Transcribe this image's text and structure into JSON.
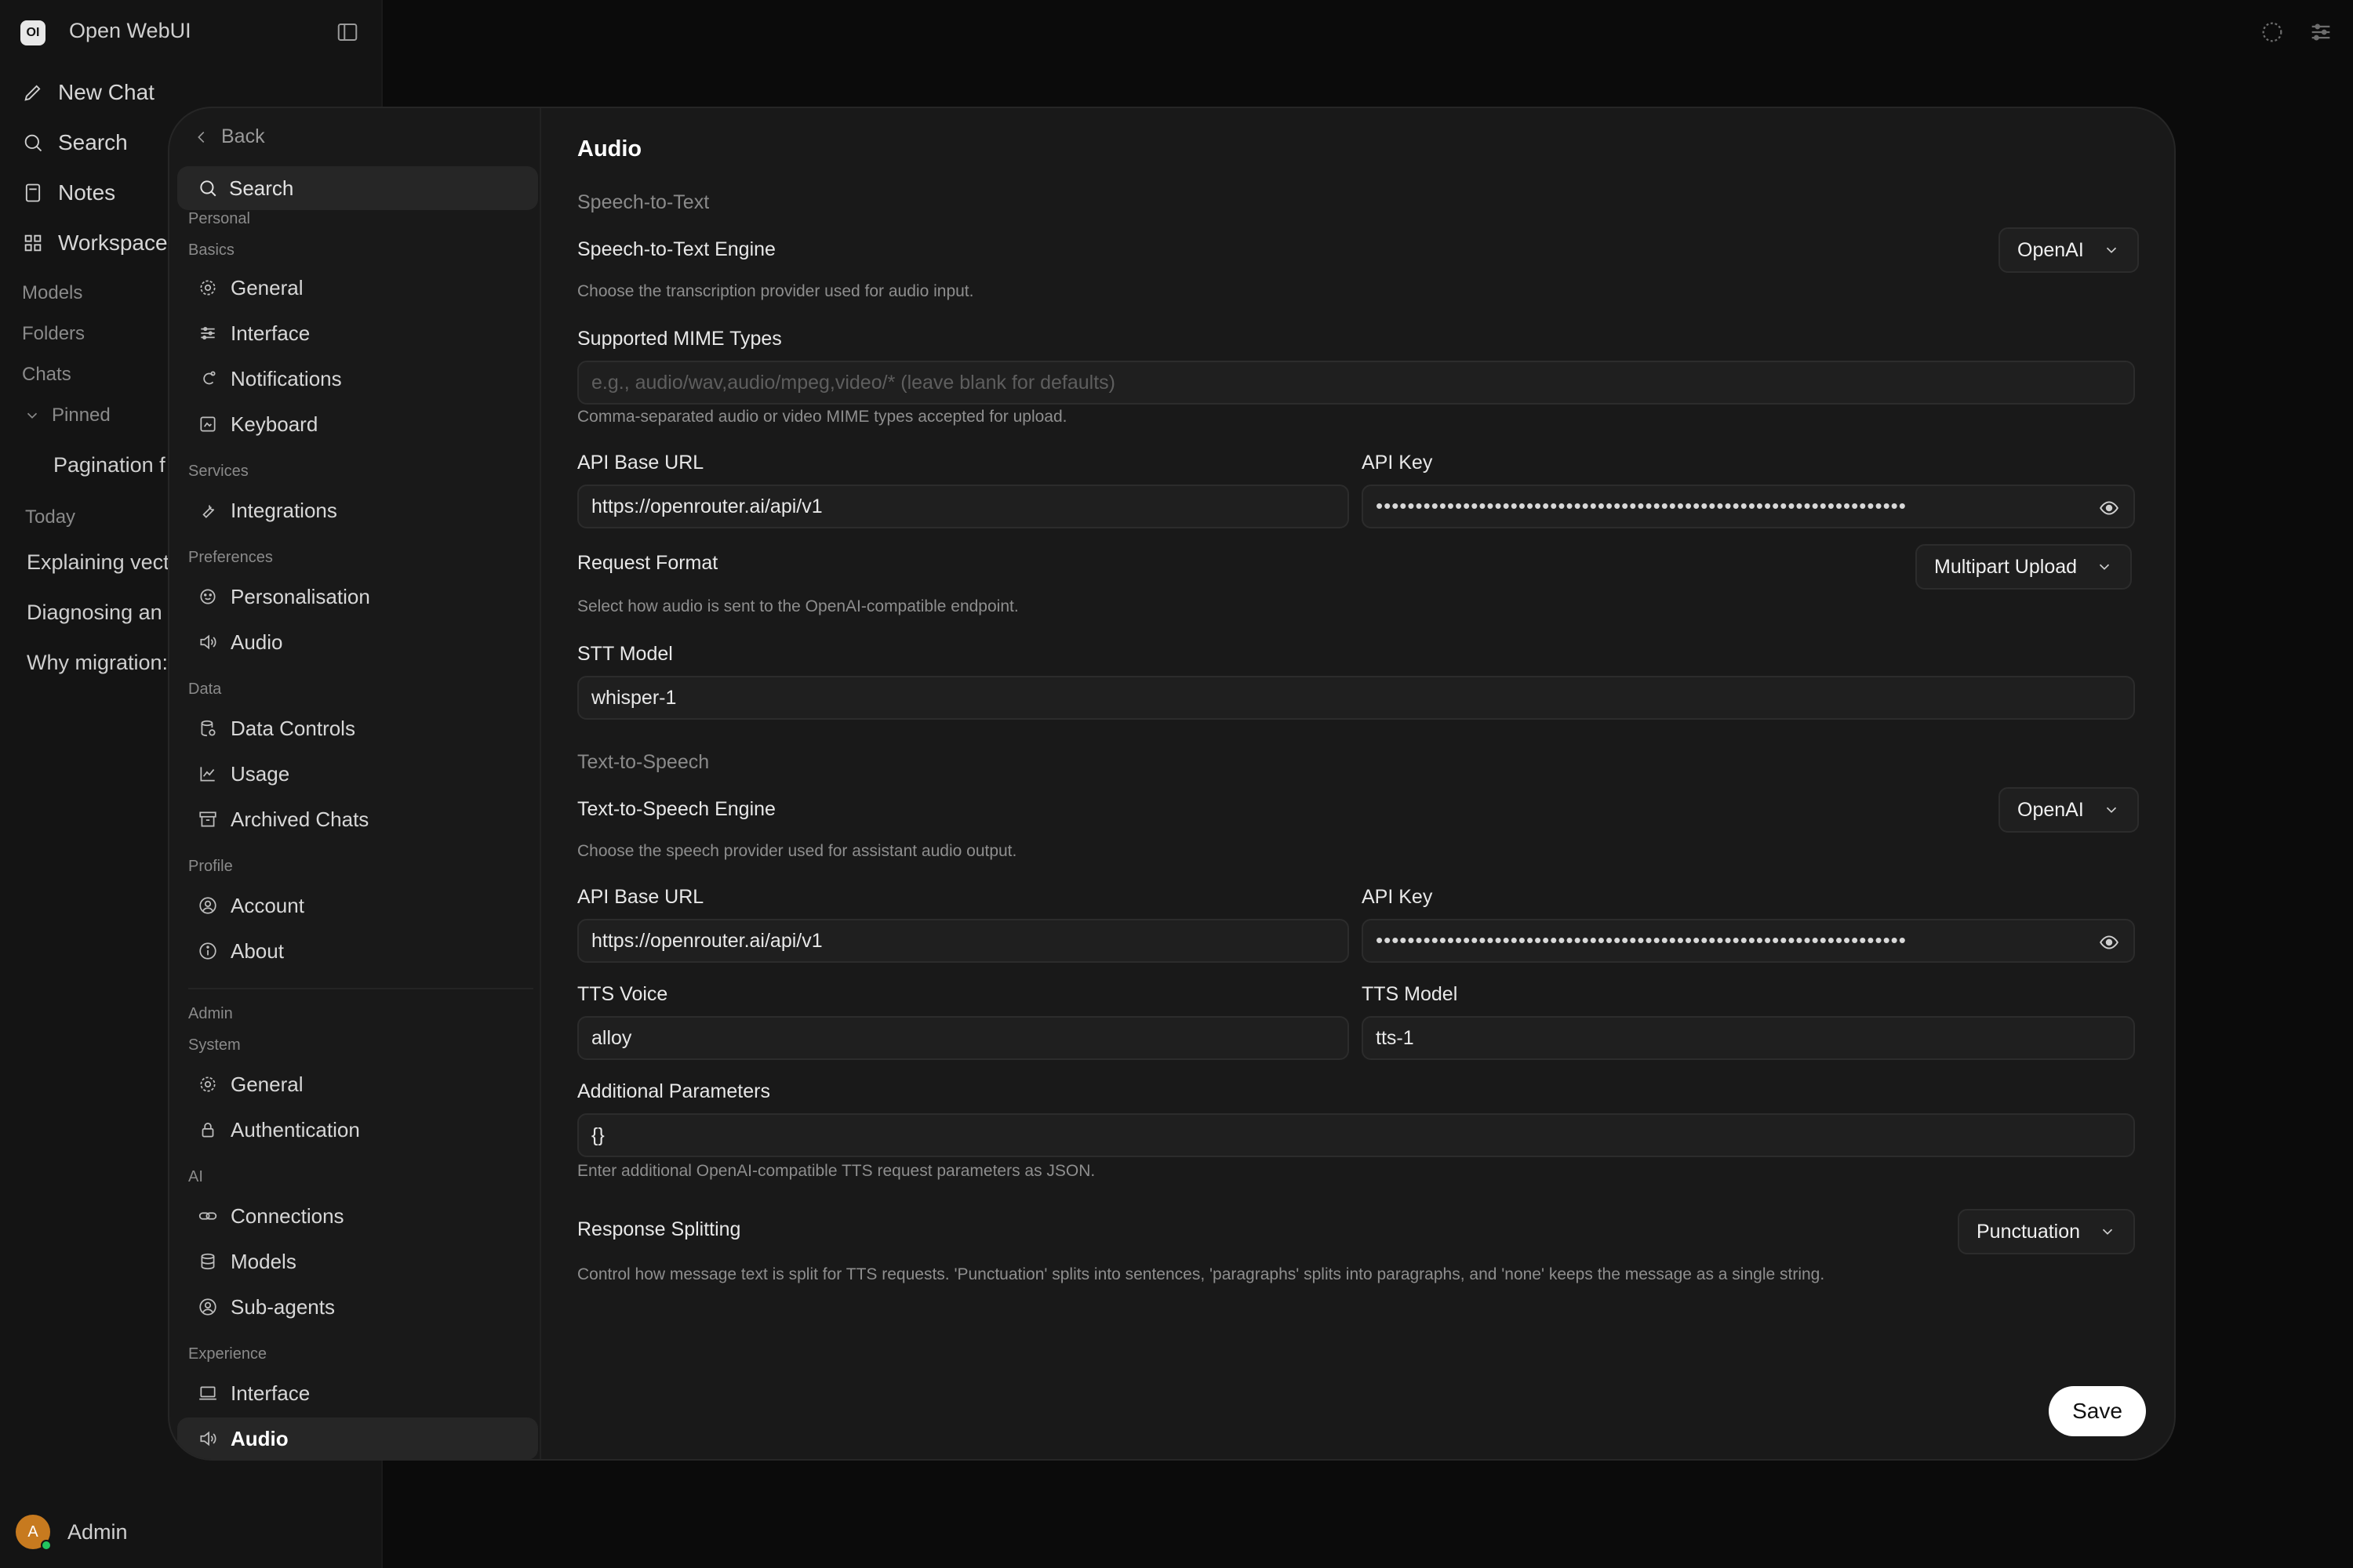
{
  "app": {
    "logo": "OI",
    "title": "Open WebUI"
  },
  "sidebar": {
    "nav": [
      {
        "label": "New Chat",
        "icon": "pencil-icon"
      },
      {
        "label": "Search",
        "icon": "search-icon"
      },
      {
        "label": "Notes",
        "icon": "notes-icon"
      },
      {
        "label": "Workspace",
        "icon": "grid-icon"
      }
    ],
    "sections": {
      "models": "Models",
      "folders": "Folders",
      "chats": "Chats",
      "pinned": "Pinned",
      "today": "Today"
    },
    "pinned_chats": [
      "Pagination f"
    ],
    "today_chats": [
      "Explaining vect",
      "Diagnosing an",
      "Why migration:"
    ],
    "user": {
      "initial": "A",
      "name": "Admin"
    }
  },
  "modal": {
    "back_label": "Back",
    "search_label": "Search",
    "groups": {
      "personal": "Personal",
      "basics": "Basics",
      "services": "Services",
      "preferences": "Preferences",
      "data": "Data",
      "profile": "Profile",
      "admin": "Admin",
      "system": "System",
      "ai": "AI",
      "experience": "Experience"
    },
    "nav": {
      "general": "General",
      "interface": "Interface",
      "notifications": "Notifications",
      "keyboard": "Keyboard",
      "integrations": "Integrations",
      "personalisation": "Personalisation",
      "audio": "Audio",
      "data_controls": "Data Controls",
      "usage": "Usage",
      "archived_chats": "Archived Chats",
      "account": "Account",
      "about": "About",
      "admin_general": "General",
      "authentication": "Authentication",
      "connections": "Connections",
      "models": "Models",
      "sub_agents": "Sub-agents",
      "exp_interface": "Interface",
      "exp_audio": "Audio"
    },
    "active_item": "Audio"
  },
  "audio": {
    "title": "Audio",
    "stt": {
      "heading": "Speech-to-Text",
      "engine_label": "Speech-to-Text Engine",
      "engine_value": "OpenAI",
      "engine_help": "Choose the transcription provider used for audio input.",
      "mime_label": "Supported MIME Types",
      "mime_placeholder": "e.g., audio/wav,audio/mpeg,video/* (leave blank for defaults)",
      "mime_help": "Comma-separated audio or video MIME types accepted for upload.",
      "base_url_label": "API Base URL",
      "base_url_value": "https://openrouter.ai/api/v1",
      "api_key_label": "API Key",
      "api_key_mask": "•••••••••••••••••••••••••••••••••••••••••••••••••••••••••••••••••••",
      "format_label": "Request Format",
      "format_value": "Multipart Upload",
      "format_help": "Select how audio is sent to the OpenAI-compatible endpoint.",
      "model_label": "STT Model",
      "model_value": "whisper-1"
    },
    "tts": {
      "heading": "Text-to-Speech",
      "engine_label": "Text-to-Speech Engine",
      "engine_value": "OpenAI",
      "engine_help": "Choose the speech provider used for assistant audio output.",
      "base_url_label": "API Base URL",
      "base_url_value": "https://openrouter.ai/api/v1",
      "api_key_label": "API Key",
      "api_key_mask": "•••••••••••••••••••••••••••••••••••••••••••••••••••••••••••••••••••",
      "voice_label": "TTS Voice",
      "voice_value": "alloy",
      "model_label": "TTS Model",
      "model_value": "tts-1",
      "params_label": "Additional Parameters",
      "params_value": "{}",
      "params_help": "Enter additional OpenAI-compatible TTS request parameters as JSON.",
      "splitting_label": "Response Splitting",
      "splitting_value": "Punctuation",
      "splitting_help": "Control how message text is split for TTS requests. 'Punctuation' splits into sentences, 'paragraphs' splits into paragraphs, and 'none' keeps the message as a single string."
    },
    "save_label": "Save"
  }
}
